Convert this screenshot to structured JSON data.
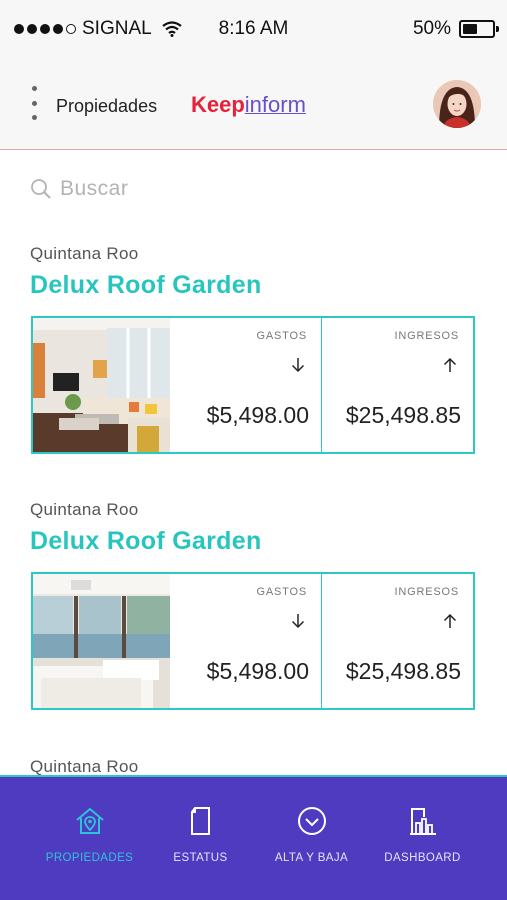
{
  "status_bar": {
    "carrier": "SIGNAL",
    "time": "8:16 AM",
    "battery": "50%",
    "battery_level": 0.5
  },
  "header": {
    "title": "Propiedades",
    "logo_part1": "Keep",
    "logo_part2": "inform"
  },
  "search": {
    "placeholder": "Buscar"
  },
  "properties": [
    {
      "location": "Quintana Roo",
      "name": "Delux Roof Garden",
      "expenses_label": "GASTOS",
      "expenses": "$5,498.00",
      "income_label": "INGRESOS",
      "income": "$25,498.85"
    },
    {
      "location": "Quintana Roo",
      "name": "Delux Roof Garden",
      "expenses_label": "GASTOS",
      "expenses": "$5,498.00",
      "income_label": "INGRESOS",
      "income": "$25,498.85"
    },
    {
      "location": "Quintana Roo"
    }
  ],
  "bottom_nav": {
    "items": [
      {
        "label": "PROPIEDADES",
        "icon": "house-pin-icon",
        "active": true
      },
      {
        "label": "ESTATUS",
        "icon": "document-icon",
        "active": false
      },
      {
        "label": "ALTA Y BAJA",
        "icon": "check-circle-icon",
        "active": false
      },
      {
        "label": "DASHBOARD",
        "icon": "bar-chart-icon",
        "active": false
      }
    ]
  },
  "colors": {
    "accent_teal": "#28c5c0",
    "brand_red": "#e8213a",
    "brand_purple": "#6b4fc8",
    "nav_background": "#4f3bbf",
    "nav_active": "#2fc3d9"
  }
}
